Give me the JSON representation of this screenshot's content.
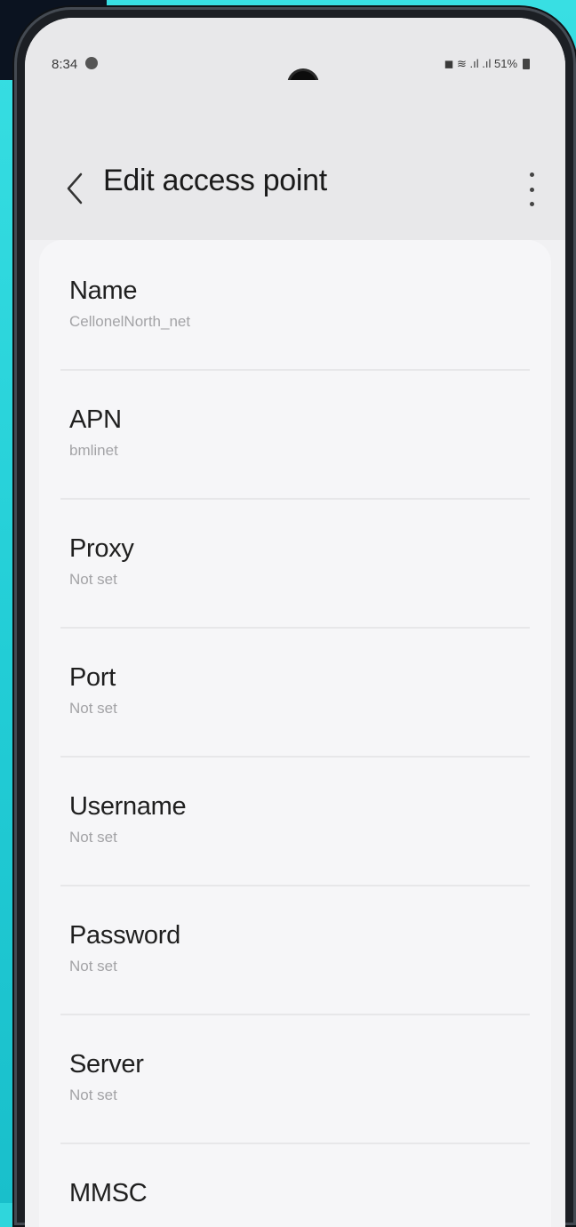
{
  "status_bar": {
    "time": "8:34",
    "right_text": "◼ ≋ .ıl .ıl 51%"
  },
  "header": {
    "title": "Edit access point"
  },
  "fields": [
    {
      "label": "Name",
      "value": "CellonelNorth_net"
    },
    {
      "label": "APN",
      "value": "bmlinet"
    },
    {
      "label": "Proxy",
      "value": "Not set"
    },
    {
      "label": "Port",
      "value": "Not set"
    },
    {
      "label": "Username",
      "value": "Not set"
    },
    {
      "label": "Password",
      "value": "Not set"
    },
    {
      "label": "Server",
      "value": "Not set"
    },
    {
      "label": "MMSC",
      "value": ""
    }
  ],
  "icons": {
    "back": "chevron-left-icon",
    "more": "more-vertical-icon",
    "settings": "gear-icon",
    "battery": "battery-icon"
  },
  "colors": {
    "background": "#2fd6dc",
    "screen": "#f1f1f3",
    "list": "#f6f6f8"
  }
}
